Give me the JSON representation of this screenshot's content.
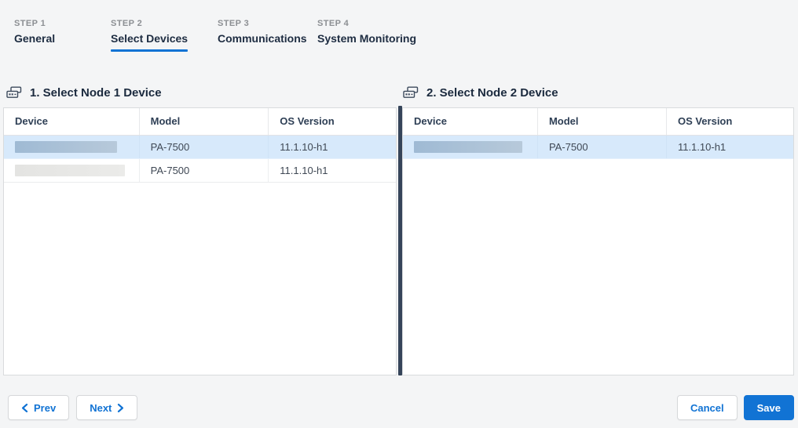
{
  "colors": {
    "accent": "#1173d4",
    "page_bg": "#f4f5f6",
    "divider": "#36455a",
    "row_selected": "#d7e9fb"
  },
  "steps": [
    {
      "step": "STEP 1",
      "label": "General",
      "active": false
    },
    {
      "step": "STEP 2",
      "label": "Select Devices",
      "active": true
    },
    {
      "step": "STEP 3",
      "label": "Communications",
      "active": false
    },
    {
      "step": "STEP 4",
      "label": "System Monitoring",
      "active": false
    }
  ],
  "panels": [
    {
      "title": "1. Select Node 1 Device",
      "icon": "device-icon",
      "columns": [
        "Device",
        "Model",
        "OS Version"
      ],
      "rows": [
        {
          "device": "",
          "device_redacted": true,
          "model": "PA-7500",
          "os_version": "11.1.10-h1",
          "selected": true
        },
        {
          "device": "",
          "device_redacted": true,
          "model": "PA-7500",
          "os_version": "11.1.10-h1",
          "selected": false
        }
      ]
    },
    {
      "title": "2. Select Node 2 Device",
      "icon": "device-icon",
      "columns": [
        "Device",
        "Model",
        "OS Version"
      ],
      "rows": [
        {
          "device": "",
          "device_redacted": true,
          "model": "PA-7500",
          "os_version": "11.1.10-h1",
          "selected": true
        }
      ]
    }
  ],
  "footer": {
    "prev_label": "Prev",
    "next_label": "Next",
    "cancel_label": "Cancel",
    "save_label": "Save"
  }
}
